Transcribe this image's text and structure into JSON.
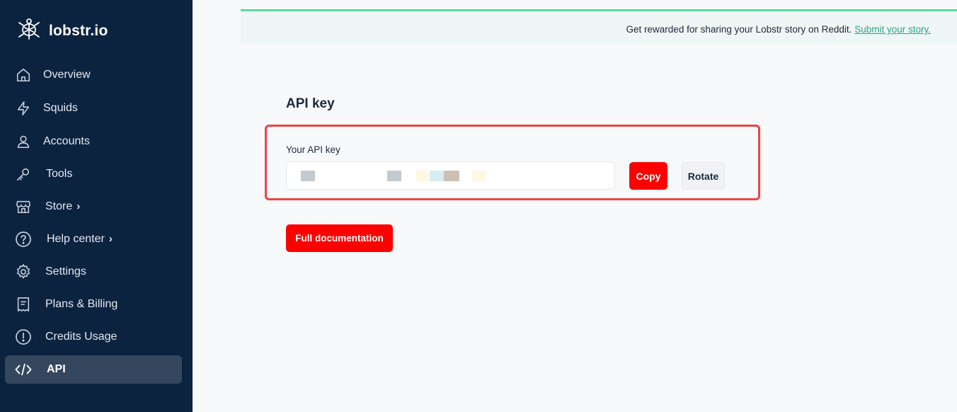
{
  "brand": {
    "name": "lobstr.io",
    "icon": "turtle-logo-icon"
  },
  "sidebar": {
    "items": [
      {
        "label": "Overview",
        "icon": "home-icon"
      },
      {
        "label": "Squids",
        "icon": "lightning-icon"
      },
      {
        "label": "Accounts",
        "icon": "user-icon"
      },
      {
        "label": "Tools",
        "icon": "key-icon"
      },
      {
        "label": "Store",
        "icon": "store-icon",
        "chevron": "›"
      },
      {
        "label": "Help center",
        "icon": "help-circle-icon",
        "chevron": "›"
      },
      {
        "label": "Settings",
        "icon": "gear-icon"
      },
      {
        "label": "Plans & Billing",
        "icon": "receipt-icon"
      },
      {
        "label": "Credits Usage",
        "icon": "alert-circle-icon"
      },
      {
        "label": "API",
        "icon": "code-icon",
        "active": true
      }
    ]
  },
  "banner": {
    "text": "Get rewarded for sharing your Lobstr story on Reddit.",
    "link": "Submit your story."
  },
  "main": {
    "title": "API key",
    "field_label": "Your API key",
    "copy_label": "Copy",
    "rotate_label": "Rotate",
    "docs_label": "Full documentation"
  },
  "colors": {
    "sidebar_bg": "#0c2340",
    "active_bg": "#34475e",
    "primary_red": "#ff0000",
    "banner_accent": "#5cd6a0",
    "link": "#2aa58a",
    "highlight_border": "#ee4444"
  }
}
